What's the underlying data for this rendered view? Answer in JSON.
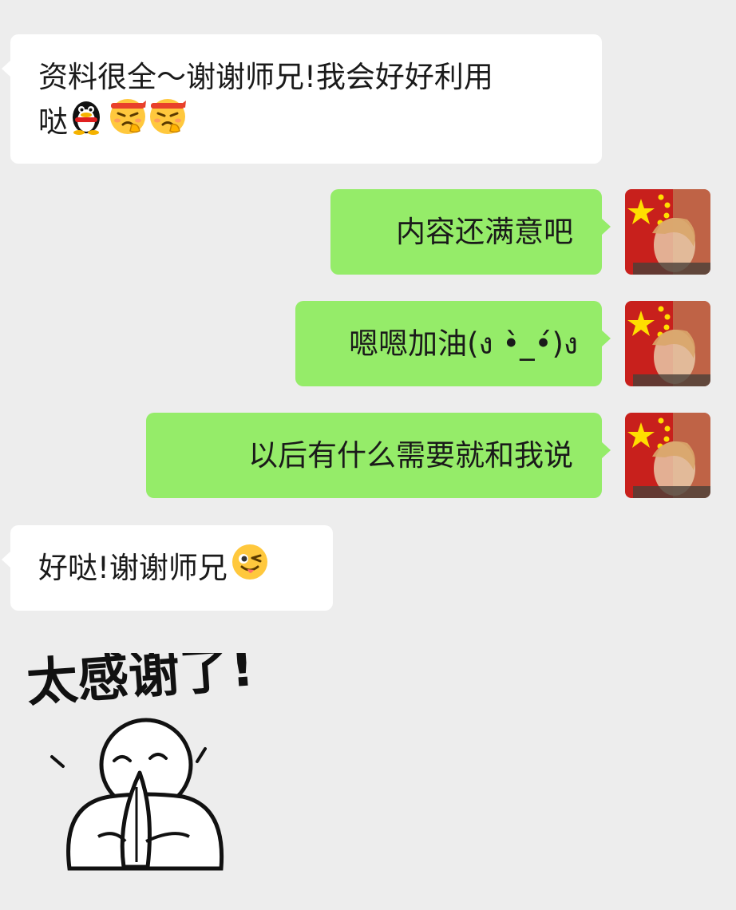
{
  "messages": [
    {
      "side": "in",
      "text_line1": "资料很全～谢谢师兄!我会好好利用",
      "text_line2": "哒",
      "emojis": [
        "qq-penguin-icon",
        "fighting-face-icon",
        "fighting-face-icon"
      ]
    },
    {
      "side": "out",
      "text": "内容还满意吧",
      "avatar": "flag-portrait-avatar"
    },
    {
      "side": "out",
      "text": "嗯嗯加油(ง •̀_•́)ง",
      "avatar": "flag-portrait-avatar"
    },
    {
      "side": "out",
      "text": "以后有什么需要就和我说",
      "avatar": "flag-portrait-avatar"
    },
    {
      "side": "in",
      "text": "好哒!谢谢师兄",
      "emojis": [
        "tongue-wink-face-icon"
      ]
    }
  ],
  "sticker": {
    "caption": "太感谢了!",
    "icon": "thankful-person-sticker"
  },
  "colors": {
    "background": "#ededed",
    "incoming": "#ffffff",
    "outgoing": "#95ec69"
  }
}
